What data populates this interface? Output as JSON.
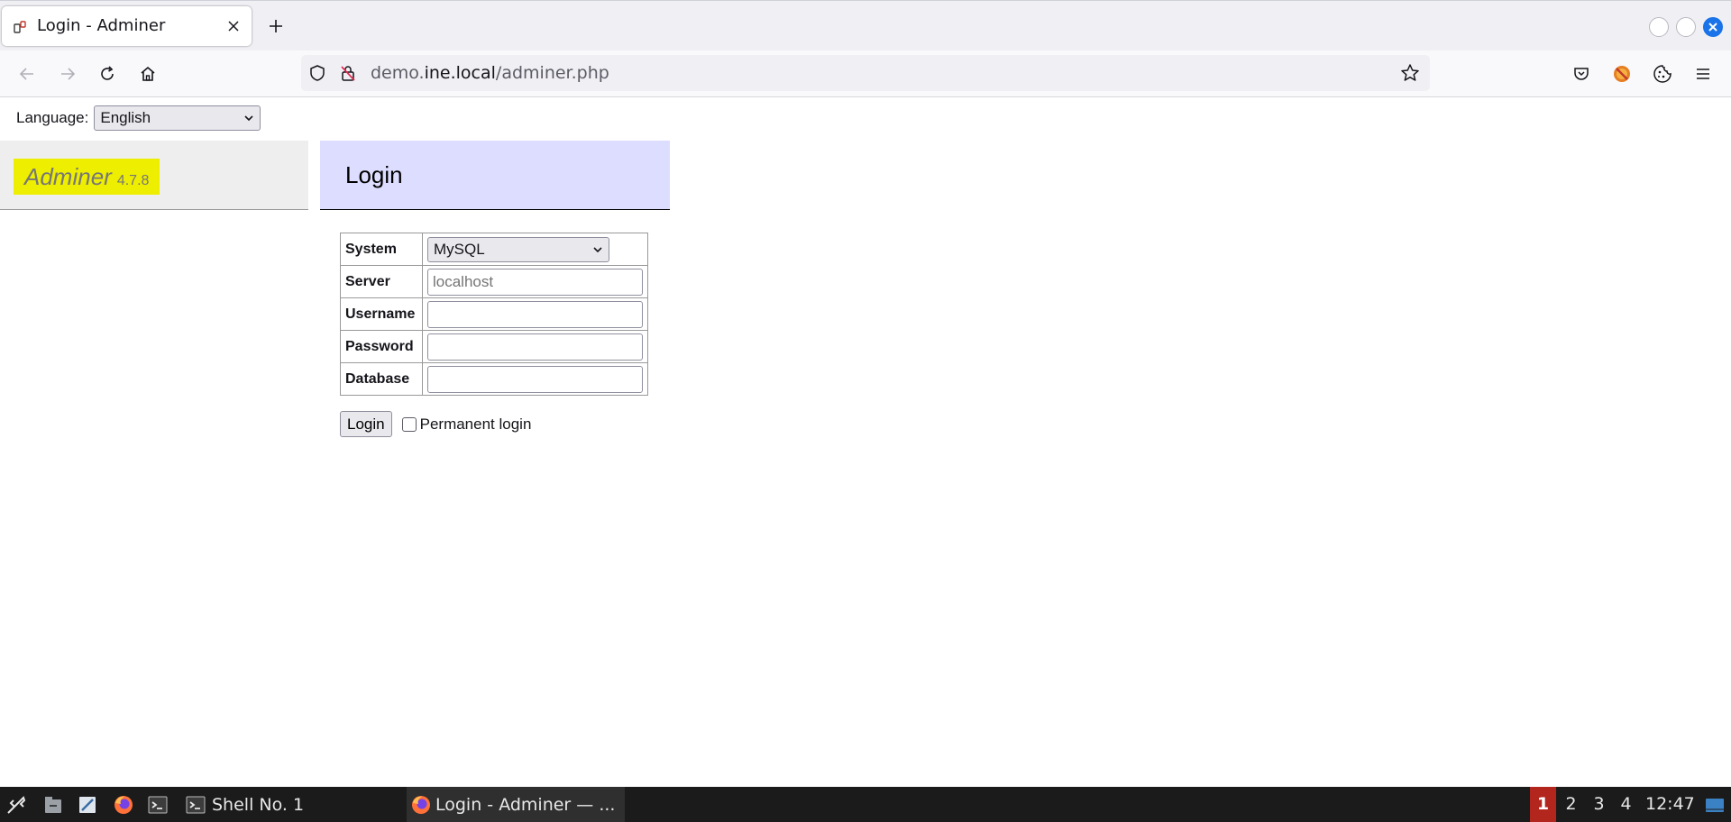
{
  "browser": {
    "tab_title": "Login - Adminer",
    "url_host_prefix": "demo.",
    "url_host": "ine.local",
    "url_path": "/adminer.php"
  },
  "page": {
    "language_label": "Language:",
    "language_selected": "English",
    "logo_name": "Adminer",
    "logo_version": "4.7.8",
    "heading": "Login",
    "form": {
      "system_label": "System",
      "system_selected": "MySQL",
      "server_label": "Server",
      "server_placeholder": "localhost",
      "username_label": "Username",
      "password_label": "Password",
      "database_label": "Database",
      "login_button": "Login",
      "permanent_login_label": "Permanent login"
    }
  },
  "taskbar": {
    "tasks": [
      {
        "label": "Shell No. 1"
      },
      {
        "label": "Login - Adminer — ..."
      }
    ],
    "workspaces": [
      "1",
      "2",
      "3",
      "4"
    ],
    "clock": "12:47"
  },
  "colors": {
    "logo_bg": "#eeee00",
    "heading_bg": "#ddddff",
    "sidebar_bg": "#eeeeee",
    "active_workspace": "#b3261e",
    "window_close": "#1a73e8"
  }
}
